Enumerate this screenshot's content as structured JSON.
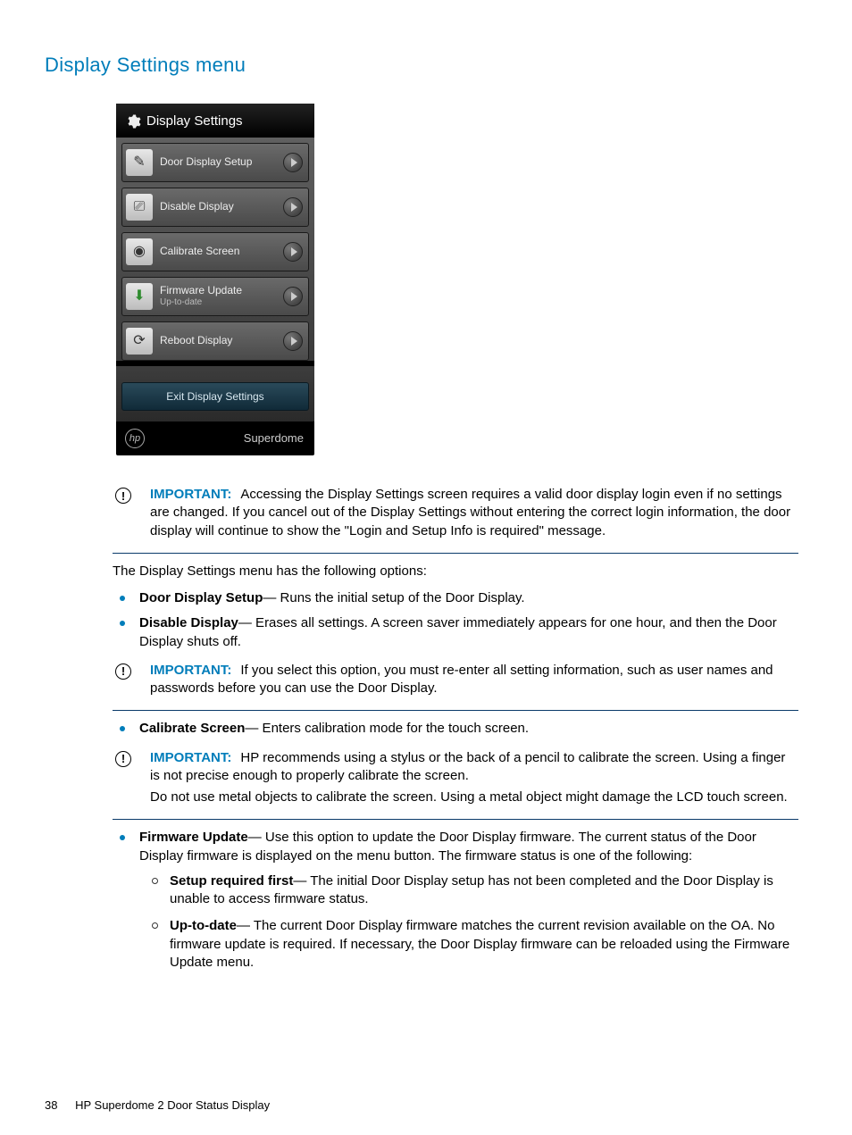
{
  "heading": "Display Settings menu",
  "screenshot": {
    "title": "Display Settings",
    "items": [
      {
        "label": "Door Display Setup",
        "sub": "",
        "icon": "✎"
      },
      {
        "label": "Disable Display",
        "sub": "",
        "icon": "⎚"
      },
      {
        "label": "Calibrate Screen",
        "sub": "",
        "icon": "◉"
      },
      {
        "label": "Firmware Update",
        "sub": "Up-to-date",
        "icon": "⬇"
      },
      {
        "label": "Reboot Display",
        "sub": "",
        "icon": "⟳"
      }
    ],
    "exit_label": "Exit Display Settings",
    "footer_logo": "hp",
    "footer_text": "Superdome"
  },
  "callouts": {
    "c1_label": "IMPORTANT:",
    "c1_text": "Accessing the Display Settings screen requires a valid door display login even if no settings are changed. If you cancel out of the Display Settings without entering the correct login information, the door display will continue to show the \"Login and Setup Info is required\" message.",
    "c2_label": "IMPORTANT:",
    "c2_text": "If you select this option, you must re-enter all setting information, such as user names and passwords before you can use the Door Display.",
    "c3_label": "IMPORTANT:",
    "c3_text1": "HP recommends using a stylus or the back of a pencil to calibrate the screen. Using a finger is not precise enough to properly calibrate the screen.",
    "c3_text2": "Do not use metal objects to calibrate the screen. Using a metal object might damage the LCD touch screen."
  },
  "intro": "The Display Settings menu has the following options:",
  "options": {
    "o1_name": "Door Display Setup",
    "o1_desc": "— Runs the initial setup of the Door Display.",
    "o2_name": "Disable Display",
    "o2_desc": "— Erases all settings. A screen saver immediately appears for one hour, and then the Door Display shuts off.",
    "o3_name": "Calibrate Screen",
    "o3_desc": "— Enters calibration mode for the touch screen.",
    "o4_name": "Firmware Update",
    "o4_desc": "— Use this option to update the Door Display firmware. The current status of the Door Display firmware is displayed on the menu button. The firmware status is one of the following:",
    "s1_name": "Setup required first",
    "s1_desc": "— The initial Door Display setup has not been completed and the Door Display is unable to access firmware status.",
    "s2_name": "Up-to-date",
    "s2_desc": "— The current Door Display firmware matches the current revision available on the OA. No firmware update is required. If necessary, the Door Display firmware can be reloaded using the Firmware Update menu."
  },
  "footer": {
    "page_num": "38",
    "doc_title": "HP Superdome 2 Door Status Display"
  }
}
